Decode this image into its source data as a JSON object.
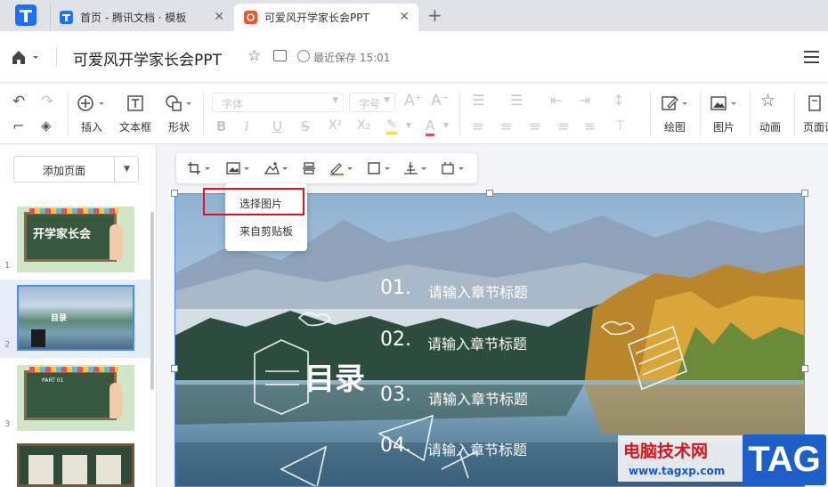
{
  "tabs": [
    {
      "label": "首页 - 腾讯文档 · 模板",
      "icon": "tencent-docs-icon"
    },
    {
      "label": "可爱风开学家长会PPT",
      "icon": "ppt-icon"
    }
  ],
  "header": {
    "doc_title": "可爱风开学家长会PPT",
    "save_status": "最近保存 15:01"
  },
  "toolbar": {
    "insert": "插入",
    "textbox": "文本框",
    "shape": "形状",
    "font_placeholder": "字体",
    "size_placeholder": "字号",
    "draw": "绘图",
    "image": "图片",
    "animation": "动画",
    "page": "页面设"
  },
  "sidebar": {
    "add_page": "添加页面",
    "thumbnails": [
      {
        "num": "1",
        "title": "开学家长会"
      },
      {
        "num": "2",
        "title": "目录"
      },
      {
        "num": "3",
        "title": "PART 01"
      },
      {
        "num": "4",
        "title": ""
      }
    ]
  },
  "image_menu": {
    "items": [
      "选择图片",
      "来自剪贴板"
    ]
  },
  "slide": {
    "title": "目录",
    "sections": [
      {
        "num": "01.",
        "label": "请输入章节标题"
      },
      {
        "num": "02.",
        "label": "请输入章节标题"
      },
      {
        "num": "03.",
        "label": "请输入章节标题"
      },
      {
        "num": "04.",
        "label": "请输入章节标题"
      }
    ]
  },
  "watermark": {
    "site_name": "电脑技术网",
    "url": "www.tagxp.com",
    "tag": "TAG"
  },
  "colors": {
    "accent": "#4d8bf0",
    "highlight_box": "#e0121c",
    "ppt_tab": "#e8582a"
  }
}
